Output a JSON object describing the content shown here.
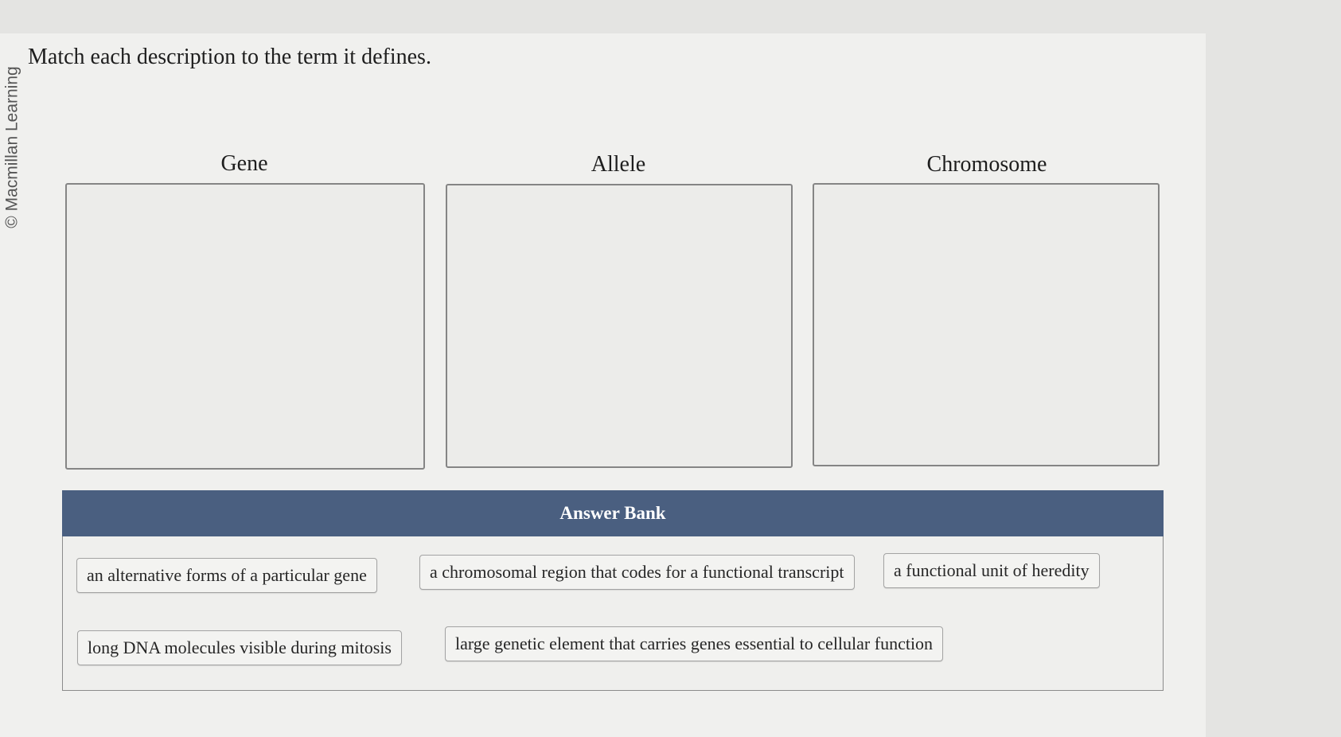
{
  "credit": "© Macmillan Learning",
  "instruction": "Match each description to the term it defines.",
  "terms": [
    {
      "label": "Gene"
    },
    {
      "label": "Allele"
    },
    {
      "label": "Chromosome"
    }
  ],
  "answer_bank": {
    "title": "Answer Bank",
    "items": [
      "an alternative forms of a particular gene",
      "a chromosomal region that codes for a functional transcript",
      "a functional unit of heredity",
      "long DNA molecules visible during mitosis",
      "large genetic element that carries genes essential to cellular function"
    ]
  }
}
